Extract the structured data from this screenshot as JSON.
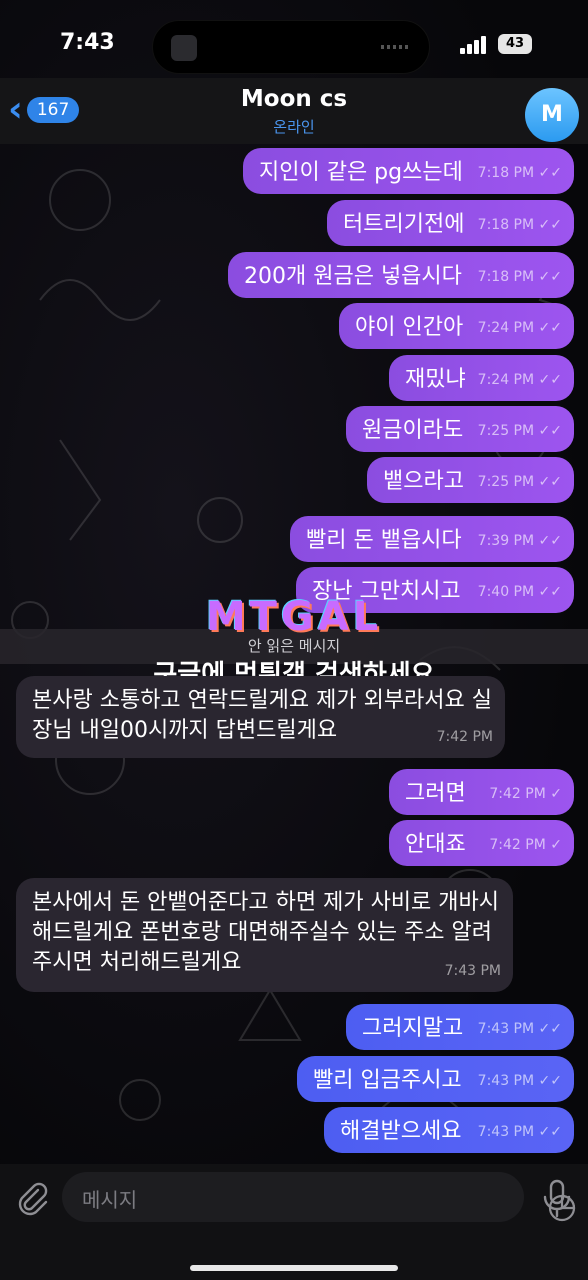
{
  "status_bar": {
    "time": "7:43",
    "battery": "43"
  },
  "header": {
    "back_count": "167",
    "title": "Moon cs",
    "status": "온라인",
    "avatar_letter": "M"
  },
  "messages": [
    {
      "text": "지인이 같은 pg쓰는데",
      "time": "7:18 PM"
    },
    {
      "text": "터트리기전에",
      "time": "7:18 PM"
    },
    {
      "text": "200개 원금은 넣읍시다",
      "time": "7:18 PM"
    },
    {
      "text": "야이 인간아",
      "time": "7:24 PM"
    },
    {
      "text": "재밌냐",
      "time": "7:24 PM"
    },
    {
      "text": "원금이라도",
      "time": "7:25 PM"
    },
    {
      "text": "뱉으라고",
      "time": "7:25 PM"
    },
    {
      "text": "빨리 돈 뱉읍시다",
      "time": "7:39 PM"
    },
    {
      "text": "장난 그만치시고",
      "time": "7:40 PM"
    },
    {
      "text": "본사랑 소통하고 연락드릴게요 제가 외부라서요 실장님 내일00시까지 답변드릴게요",
      "time": "7:42 PM"
    },
    {
      "text": "그러면",
      "time": "7:42 PM"
    },
    {
      "text": "안대죠",
      "time": "7:42 PM"
    },
    {
      "text": "본사에서 돈 안뱉어준다고 하면 제가 사비로 개바시해드릴게요 폰번호랑 대면해주실수 있는 주소 알려주시면 처리해드릴게요",
      "time": "7:43 PM"
    },
    {
      "text": "그러지말고",
      "time": "7:43 PM"
    },
    {
      "text": "빨리 입금주시고",
      "time": "7:43 PM"
    },
    {
      "text": "해결받으세요",
      "time": "7:43 PM"
    }
  ],
  "unread_divider": "안 읽은 메시지",
  "watermark": {
    "logo": "MTGAL",
    "text": "구글에 먹튀갤 검색하세요"
  },
  "input": {
    "placeholder": "메시지"
  },
  "colors": {
    "outgoing": "#9450e8",
    "outgoing_blue": "#5462f3",
    "incoming": "#2a2630",
    "accent": "#3b8df0"
  },
  "icons": [
    "back-chevron-icon",
    "signal-icon",
    "battery-icon",
    "attach-icon",
    "sticker-icon",
    "mic-icon",
    "double-check-icon",
    "single-check-icon"
  ]
}
